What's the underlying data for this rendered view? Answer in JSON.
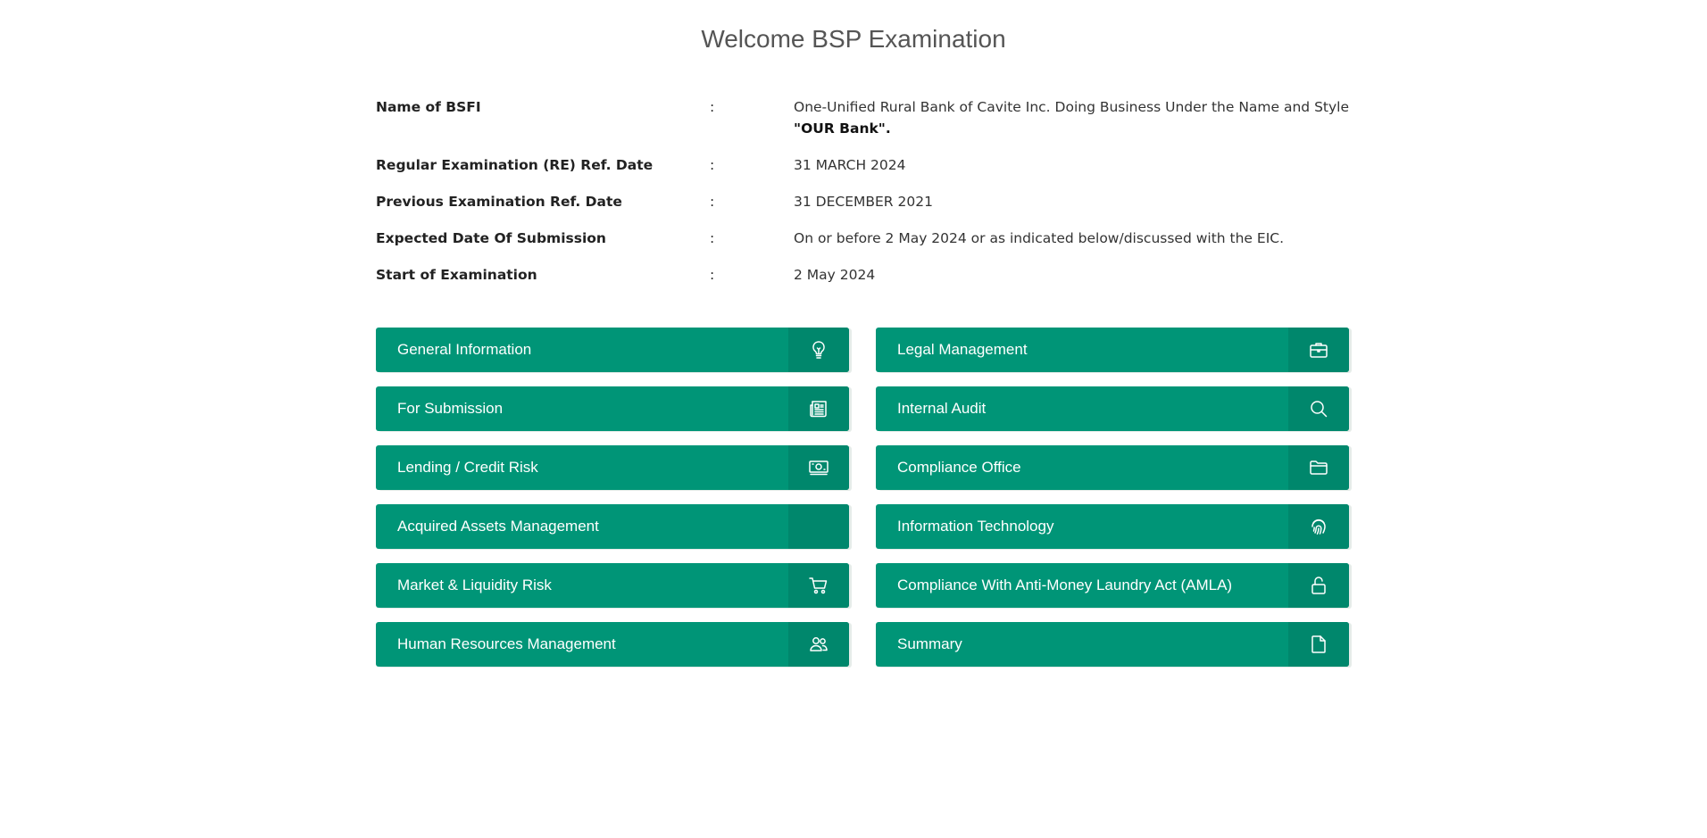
{
  "page": {
    "title": "Welcome BSP Examination"
  },
  "info": {
    "colon": ":",
    "rows": [
      {
        "label": "Name of BSFI",
        "value": "One-Unified Rural Bank of Cavite Inc. Doing Business Under the Name and Style",
        "value_bold": "\"OUR Bank\"."
      },
      {
        "label": "Regular Examination (RE) Ref. Date",
        "value": "31 MARCH 2024"
      },
      {
        "label": "Previous Examination Ref. Date",
        "value": "31 DECEMBER 2021"
      },
      {
        "label": "Expected Date Of Submission",
        "value": "On or before 2 May 2024 or as indicated below/discussed with the EIC."
      },
      {
        "label": "Start of Examination",
        "value": "2 May 2024"
      }
    ]
  },
  "colors": {
    "tile": "#009577",
    "tile_icon_bg": "#00876c"
  },
  "tiles": [
    {
      "label": "General Information",
      "icon": "lightbulb-icon"
    },
    {
      "label": "Legal Management",
      "icon": "briefcase-icon"
    },
    {
      "label": "For Submission",
      "icon": "newspaper-icon"
    },
    {
      "label": "Internal Audit",
      "icon": "search-icon"
    },
    {
      "label": "Lending / Credit Risk",
      "icon": "cash-icon"
    },
    {
      "label": "Compliance Office",
      "icon": "folder-icon"
    },
    {
      "label": "Acquired Assets Management",
      "icon": ""
    },
    {
      "label": "Information Technology",
      "icon": "fingerprint-icon"
    },
    {
      "label": "Market & Liquidity Risk",
      "icon": "cart-icon"
    },
    {
      "label": "Compliance With Anti-Money Laundry Act (AMLA)",
      "icon": "lock-icon"
    },
    {
      "label": "Human Resources Management",
      "icon": "people-icon"
    },
    {
      "label": "Summary",
      "icon": "file-icon"
    }
  ]
}
